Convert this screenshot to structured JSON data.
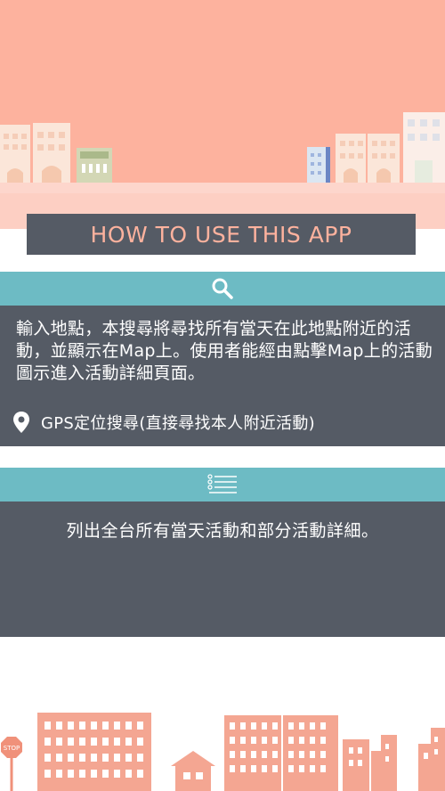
{
  "header": {
    "title": "HOW TO USE THIS APP"
  },
  "search_section": {
    "icon": "search-icon",
    "description": "輸入地點，本搜尋將尋找所有當天在此地點附近的活動，並顯示在Map上。使用者能經由點擊Map上的活動圖示進入活動詳細頁面。",
    "gps_icon": "location-pin-icon",
    "gps_label": "GPS定位搜尋(直接尋找本人附近活動)"
  },
  "list_section": {
    "icon": "list-icon",
    "description": "列出全台所有當天活動和部分活動詳細。"
  },
  "illustration": {
    "stop_sign": "STOP"
  },
  "colors": {
    "sky": "#fdb29e",
    "title_bar": "#555b65",
    "accent_teal": "#6dbbc4",
    "panel": "#555b65",
    "title_text": "#fdb29e"
  }
}
